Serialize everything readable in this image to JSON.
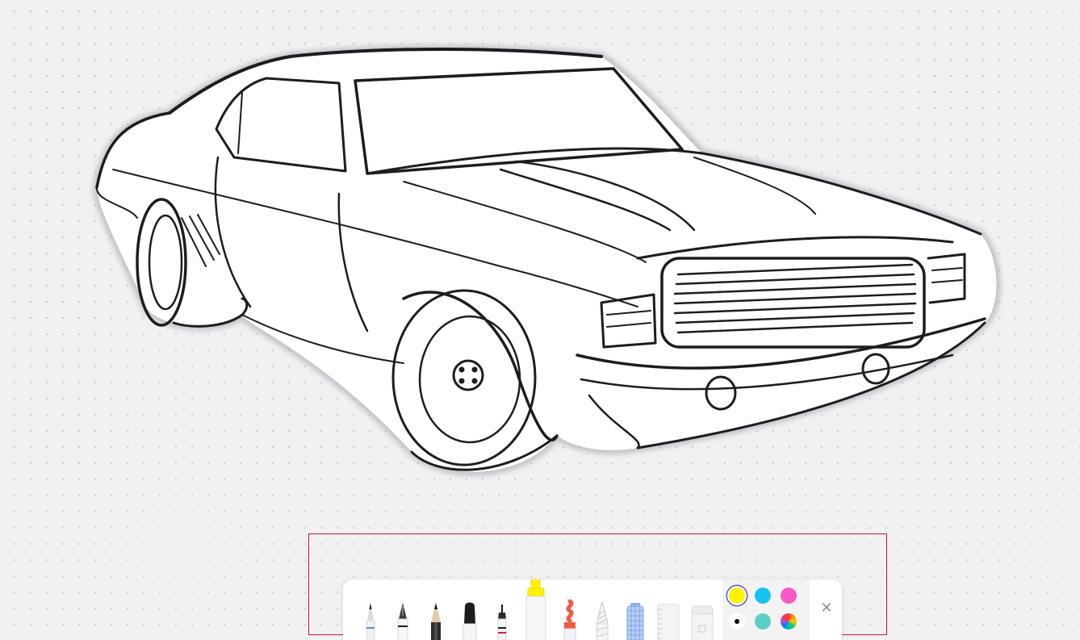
{
  "canvas": {
    "background": "#f1f1f4",
    "drawing_subject": "car-sketch"
  },
  "toolbar": {
    "tools": [
      {
        "name": "monoline-pen",
        "icon": "monoline-pen-icon"
      },
      {
        "name": "fountain-pen",
        "icon": "fountain-pen-icon"
      },
      {
        "name": "pencil",
        "icon": "pencil-icon"
      },
      {
        "name": "marker",
        "icon": "marker-icon"
      },
      {
        "name": "fineliner",
        "icon": "fineliner-icon"
      },
      {
        "name": "highlighter",
        "icon": "highlighter-icon",
        "selected": true
      },
      {
        "name": "watercolor",
        "icon": "watercolor-icon"
      },
      {
        "name": "crayon",
        "icon": "crayon-icon"
      },
      {
        "name": "fill",
        "icon": "fill-icon"
      },
      {
        "name": "ruler",
        "icon": "ruler-icon"
      },
      {
        "name": "eraser",
        "icon": "eraser-icon"
      }
    ],
    "colors": [
      {
        "name": "yellow",
        "hex": "#fff200",
        "selected": true
      },
      {
        "name": "cyan",
        "hex": "#18c3f2"
      },
      {
        "name": "pink",
        "hex": "#f35ac3"
      },
      {
        "name": "black",
        "hex": "#000000"
      },
      {
        "name": "teal",
        "hex": "#5ccfc4"
      },
      {
        "name": "custom",
        "hex": "multicolor"
      }
    ],
    "close_label": "✕"
  }
}
